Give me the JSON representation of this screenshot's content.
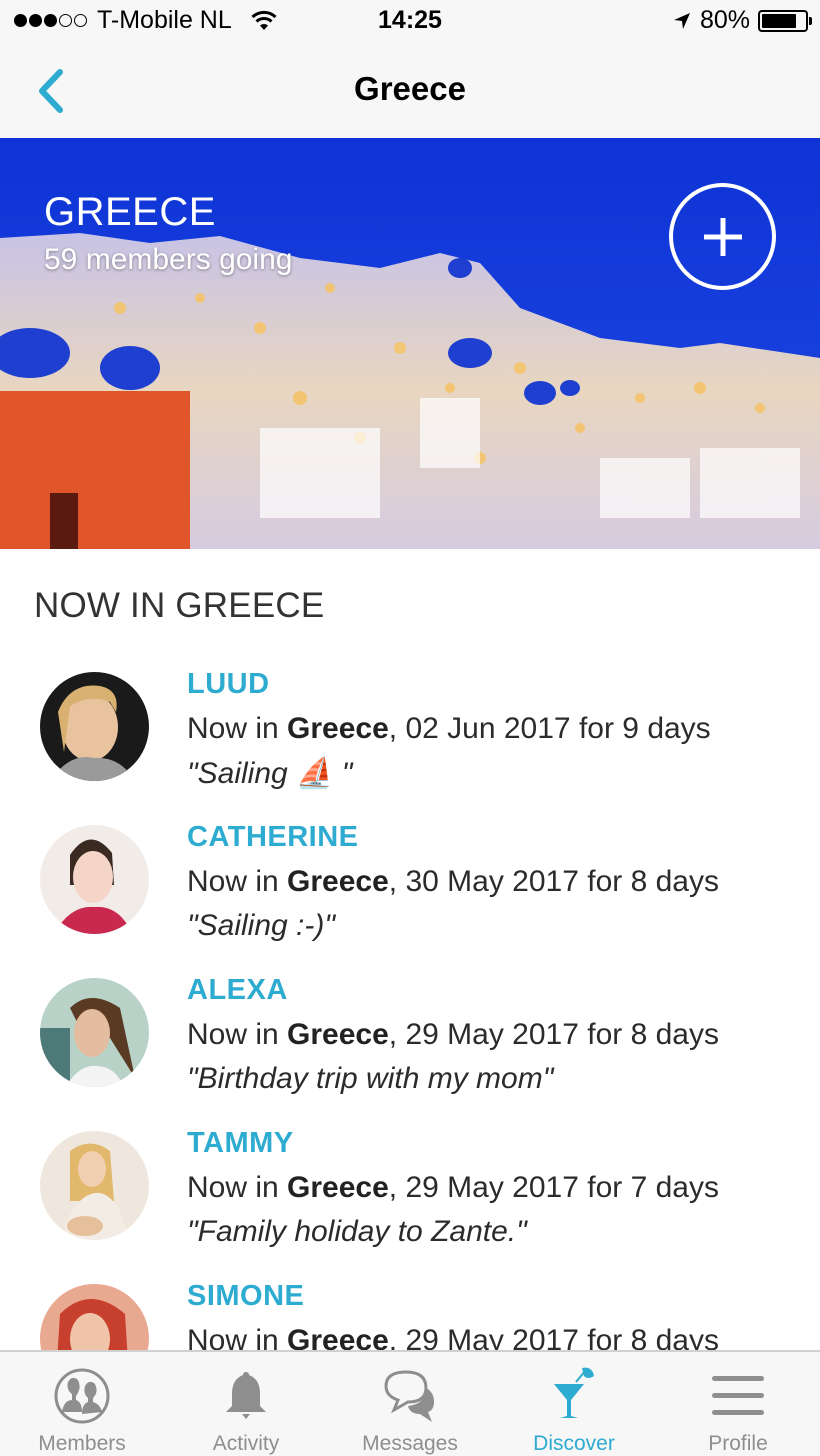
{
  "status_bar": {
    "signal_bars_filled": 3,
    "signal_bars_total": 5,
    "carrier": "T-Mobile NL",
    "wifi_icon": "wifi-icon",
    "time": "14:25",
    "location_icon": "location-arrow-icon",
    "battery_percent_text": "80%",
    "battery_level": 0.8
  },
  "nav": {
    "back_icon": "chevron-left-icon",
    "title": "Greece"
  },
  "hero": {
    "title": "GREECE",
    "subtitle": "59 members going",
    "add_icon": "plus-circle-icon"
  },
  "section": {
    "title": "NOW IN GREECE"
  },
  "members": [
    {
      "name": "LUUD",
      "prefix": "Now in ",
      "place": "Greece",
      "suffix": ", 02 Jun 2017 for 9 days",
      "quote": "\"Sailing ⛵ \""
    },
    {
      "name": "CATHERINE",
      "prefix": "Now in ",
      "place": "Greece",
      "suffix": ", 30 May 2017 for 8 days",
      "quote": "\"Sailing :-)\""
    },
    {
      "name": "ALEXA",
      "prefix": "Now in ",
      "place": "Greece",
      "suffix": ", 29 May 2017 for 8 days",
      "quote": "\"Birthday trip with my mom\""
    },
    {
      "name": "TAMMY",
      "prefix": "Now in ",
      "place": "Greece",
      "suffix": ", 29 May 2017 for 7 days",
      "quote": "\"Family holiday to Zante.\""
    },
    {
      "name": "SIMONE",
      "prefix": "Now in ",
      "place": "Greece",
      "suffix": ", 29 May 2017 for 8 days",
      "quote": ""
    }
  ],
  "tabs": [
    {
      "label": "Members",
      "icon": "members-icon",
      "active": false
    },
    {
      "label": "Activity",
      "icon": "bell-icon",
      "active": false
    },
    {
      "label": "Messages",
      "icon": "chat-bubbles-icon",
      "active": false
    },
    {
      "label": "Discover",
      "icon": "cocktail-icon",
      "active": true
    },
    {
      "label": "Profile",
      "icon": "hamburger-menu-icon",
      "active": false
    }
  ],
  "colors": {
    "accent": "#2eabd0",
    "tab_inactive": "#8e8e8e",
    "bar_background": "#f7f7f7",
    "hero_sky": "#1136d8"
  }
}
